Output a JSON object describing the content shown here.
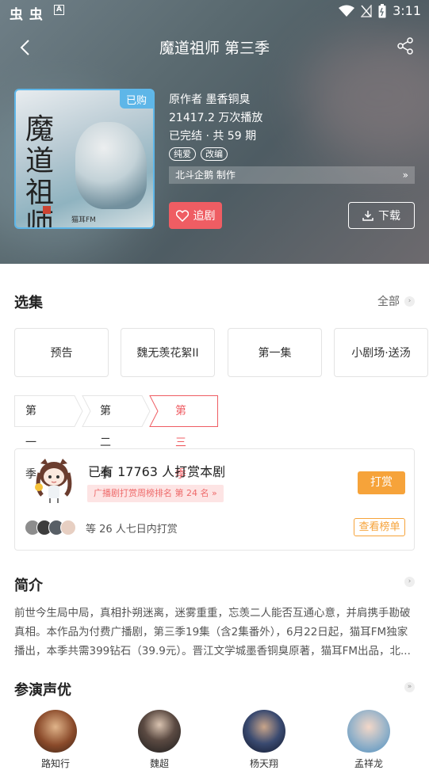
{
  "status": {
    "time": "3:11",
    "left_icons": "虫 虫"
  },
  "nav": {
    "title": "魔道祖师 第三季"
  },
  "cover": {
    "badge": "已购",
    "calligraphy": "魔道祖师",
    "publisher": "猫耳FM"
  },
  "info": {
    "author": "原作者 墨香铜臭",
    "plays": "21417.2 万次播放",
    "episodes": "已完结 · 共 59 期",
    "tags": [
      "纯爱",
      "改编"
    ],
    "producer": "北斗企鹅 制作"
  },
  "actions": {
    "follow_label": "追剧",
    "download_label": "下载"
  },
  "episodes_section": {
    "title": "选集",
    "more_label": "全部",
    "items": [
      "预告",
      "魏无羡花絮II",
      "第一集",
      "小剧场·送汤"
    ],
    "seasons": [
      "第一季",
      "第二季",
      "第三季"
    ],
    "active_season_index": 2
  },
  "reward": {
    "title": "已有 17763 人打赏本剧",
    "rank_label": "广播剧打赏周榜排名 第 24 名",
    "tip_label": "打赏",
    "weekly_text": "等 26 人七日内打赏",
    "rank_button": "查看榜单"
  },
  "intro": {
    "title": "简介",
    "text": "前世今生局中局，真相扑朔迷离，迷雾重重，忘羡二人能否互通心意，并肩携手勘破真相。本作品为付费广播剧，第三季19集（含2集番外），6月22日起，猫耳FM独家播出，本季共需399钻石（39.9元）。晋江文学城墨香铜臭原著，猫耳FM出品，北..."
  },
  "cast": {
    "title": "参演声优",
    "names": [
      "路知行",
      "魏超",
      "杨天翔",
      "孟祥龙"
    ]
  },
  "colors": {
    "accent": "#ef5d63",
    "orange": "#f6a33a",
    "blue": "#5eb6e8"
  }
}
